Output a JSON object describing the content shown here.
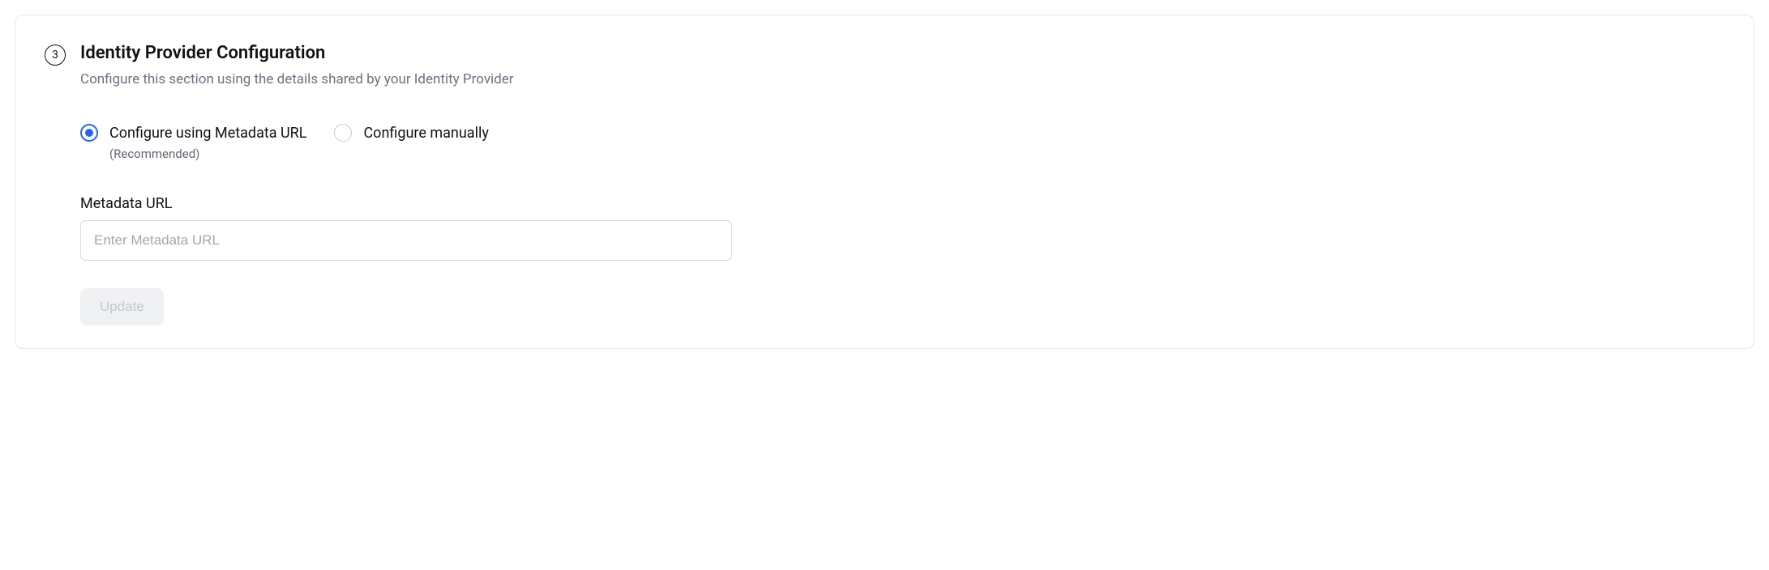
{
  "step": {
    "number": "3",
    "title": "Identity Provider Configuration",
    "subtitle": "Configure this section using the details shared by your Identity Provider"
  },
  "radios": {
    "option1": {
      "label": "Configure using Metadata URL",
      "sublabel": "(Recommended)"
    },
    "option2": {
      "label": "Configure manually"
    }
  },
  "field": {
    "label": "Metadata URL",
    "placeholder": "Enter Metadata URL",
    "value": ""
  },
  "button": {
    "update": "Update"
  }
}
